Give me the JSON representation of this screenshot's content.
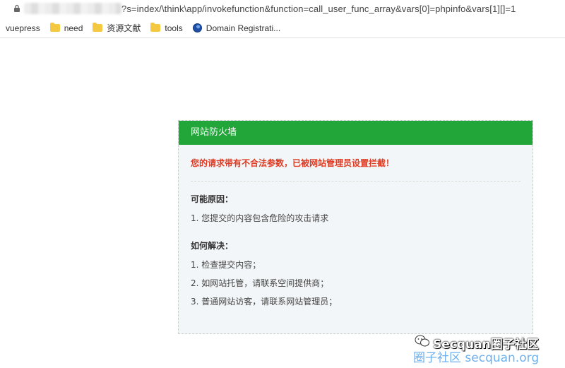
{
  "browser": {
    "url_visible": "?s=index/\\think\\app/invokefunction&function=call_user_func_array&vars[0]=phpinfo&vars[1][]=1",
    "bookmarks": [
      {
        "label": "vuepress",
        "icon": "none"
      },
      {
        "label": "need",
        "icon": "folder-icon"
      },
      {
        "label": "资源文献",
        "icon": "folder-icon"
      },
      {
        "label": "tools",
        "icon": "folder-icon"
      },
      {
        "label": "Domain Registrati...",
        "icon": "globe-icon"
      }
    ]
  },
  "firewall": {
    "title": "网站防火墙",
    "warning": "您的请求带有不合法参数，已被网站管理员设置拦截！",
    "reasons_title": "可能原因：",
    "reasons": [
      "1.  您提交的内容包含危险的攻击请求"
    ],
    "solutions_title": "如何解决：",
    "solutions": [
      "1.  检查提交内容；",
      "2.  如网站托管，请联系空间提供商；",
      "3.  普通网站访客，请联系网站管理员；"
    ]
  },
  "watermark": {
    "line1": "Secquan圈子社区",
    "line2": "圈子社区 secquan.org"
  },
  "colors": {
    "header_green": "#22a539",
    "warning_red": "#e03b22",
    "card_bg": "#f3f6f8"
  }
}
